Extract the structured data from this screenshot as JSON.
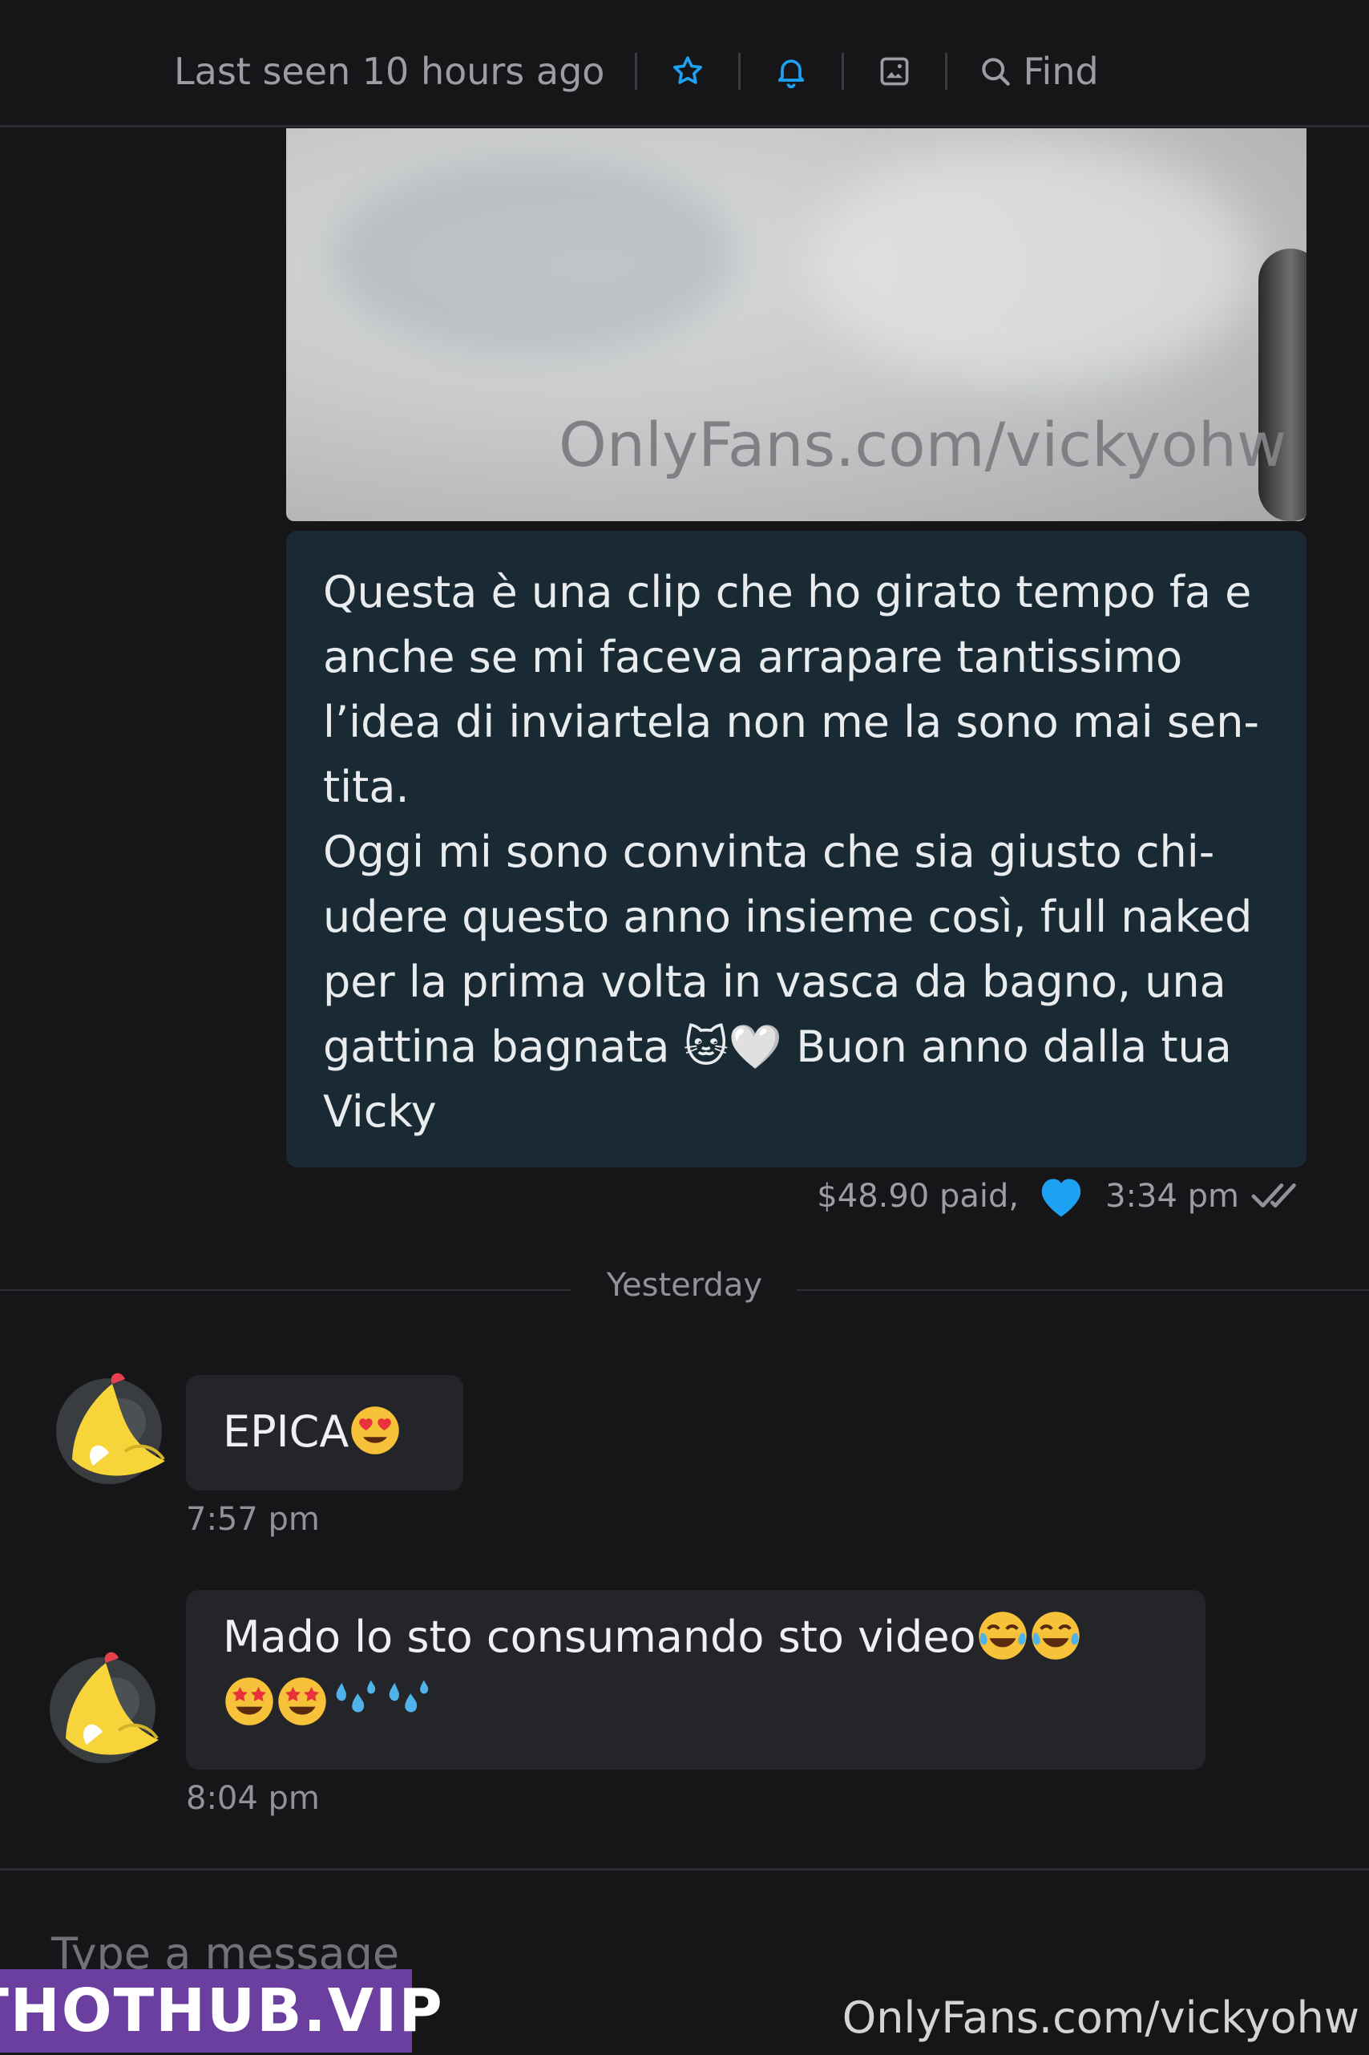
{
  "header": {
    "last_seen": "Last seen 10 hours ago",
    "icons": [
      "star-icon",
      "bell-icon",
      "gallery-icon",
      "search-icon"
    ],
    "find_label": "Find"
  },
  "media": {
    "watermark": "OnlyFans.com/vickyohw"
  },
  "outgoing_message": {
    "text": "Questa è una clip che ho girato tempo fa e\nanche se mi faceva arrapare tantissimo\nl’idea di inviartela non me la sono mai sen-\ntita.\nOggi mi sono convinta che sia giusto chi-\nudere questo anno insieme così, full naked\nper la prima volta in vasca da bagno, una\ngattina bagnata 🐱🤍 Buon anno dalla tua\nVicky",
    "price": "$48.90 paid,",
    "time": "3:34 pm"
  },
  "divider_label": "Yesterday",
  "incoming_messages": [
    {
      "text": "EPICA",
      "emojis": [
        "heart-eyes"
      ],
      "time": "7:57 pm"
    },
    {
      "line1": "Mado lo sto consumando sto video",
      "emojis_line1": [
        "tears-of-joy",
        "tears-of-joy"
      ],
      "emojis_line2": [
        "star-struck",
        "star-struck",
        "sweat-droplets",
        "sweat-droplets"
      ],
      "time": "8:04 pm"
    }
  ],
  "composer": {
    "placeholder": "Type a message"
  },
  "overlays": {
    "badge": "THOTHUB.VIP",
    "watermark_bottom": "OnlyFans.com/vickyohw"
  },
  "colors": {
    "accent": "#1da1f2",
    "background": "#161618",
    "outgoing_bubble": "#1a2a35",
    "incoming_bubble": "#242529"
  }
}
